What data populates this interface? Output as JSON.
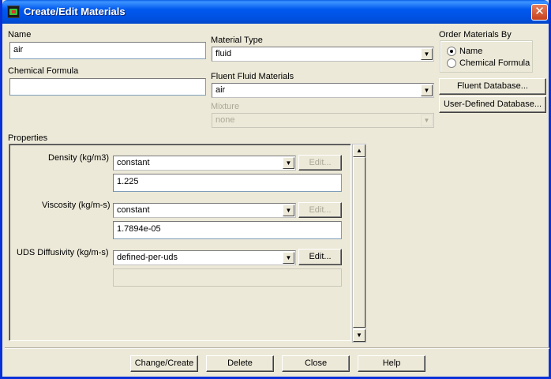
{
  "window": {
    "title": "Create/Edit Materials",
    "close_symbol": "✕"
  },
  "name": {
    "label": "Name",
    "value": "air"
  },
  "chemical_formula": {
    "label": "Chemical Formula",
    "value": ""
  },
  "material_type": {
    "label": "Material Type",
    "value": "fluid"
  },
  "fluent_fluid_materials": {
    "label": "Fluent Fluid Materials",
    "value": "air"
  },
  "mixture": {
    "label": "Mixture",
    "value": "none",
    "enabled": false
  },
  "order_by": {
    "label": "Order Materials By",
    "options": [
      {
        "label": "Name",
        "selected": true
      },
      {
        "label": "Chemical Formula",
        "selected": false
      }
    ]
  },
  "database_buttons": {
    "fluent": "Fluent Database...",
    "user_defined": "User-Defined Database..."
  },
  "properties": {
    "label": "Properties",
    "items": [
      {
        "label": "Density (kg/m3)",
        "method": "constant",
        "value": "1.225",
        "edit_label": "Edit...",
        "edit_enabled": false
      },
      {
        "label": "Viscosity (kg/m-s)",
        "method": "constant",
        "value": "1.7894e-05",
        "edit_label": "Edit...",
        "edit_enabled": false
      },
      {
        "label": "UDS Diffusivity (kg/m-s)",
        "method": "defined-per-uds",
        "value": "",
        "edit_label": "Edit...",
        "edit_enabled": true
      }
    ]
  },
  "icons": {
    "combo_arrow": "▼",
    "scroll_up": "▲",
    "scroll_down": "▼"
  },
  "bottom_buttons": {
    "change_create": "Change/Create",
    "delete": "Delete",
    "close": "Close",
    "help": "Help"
  }
}
